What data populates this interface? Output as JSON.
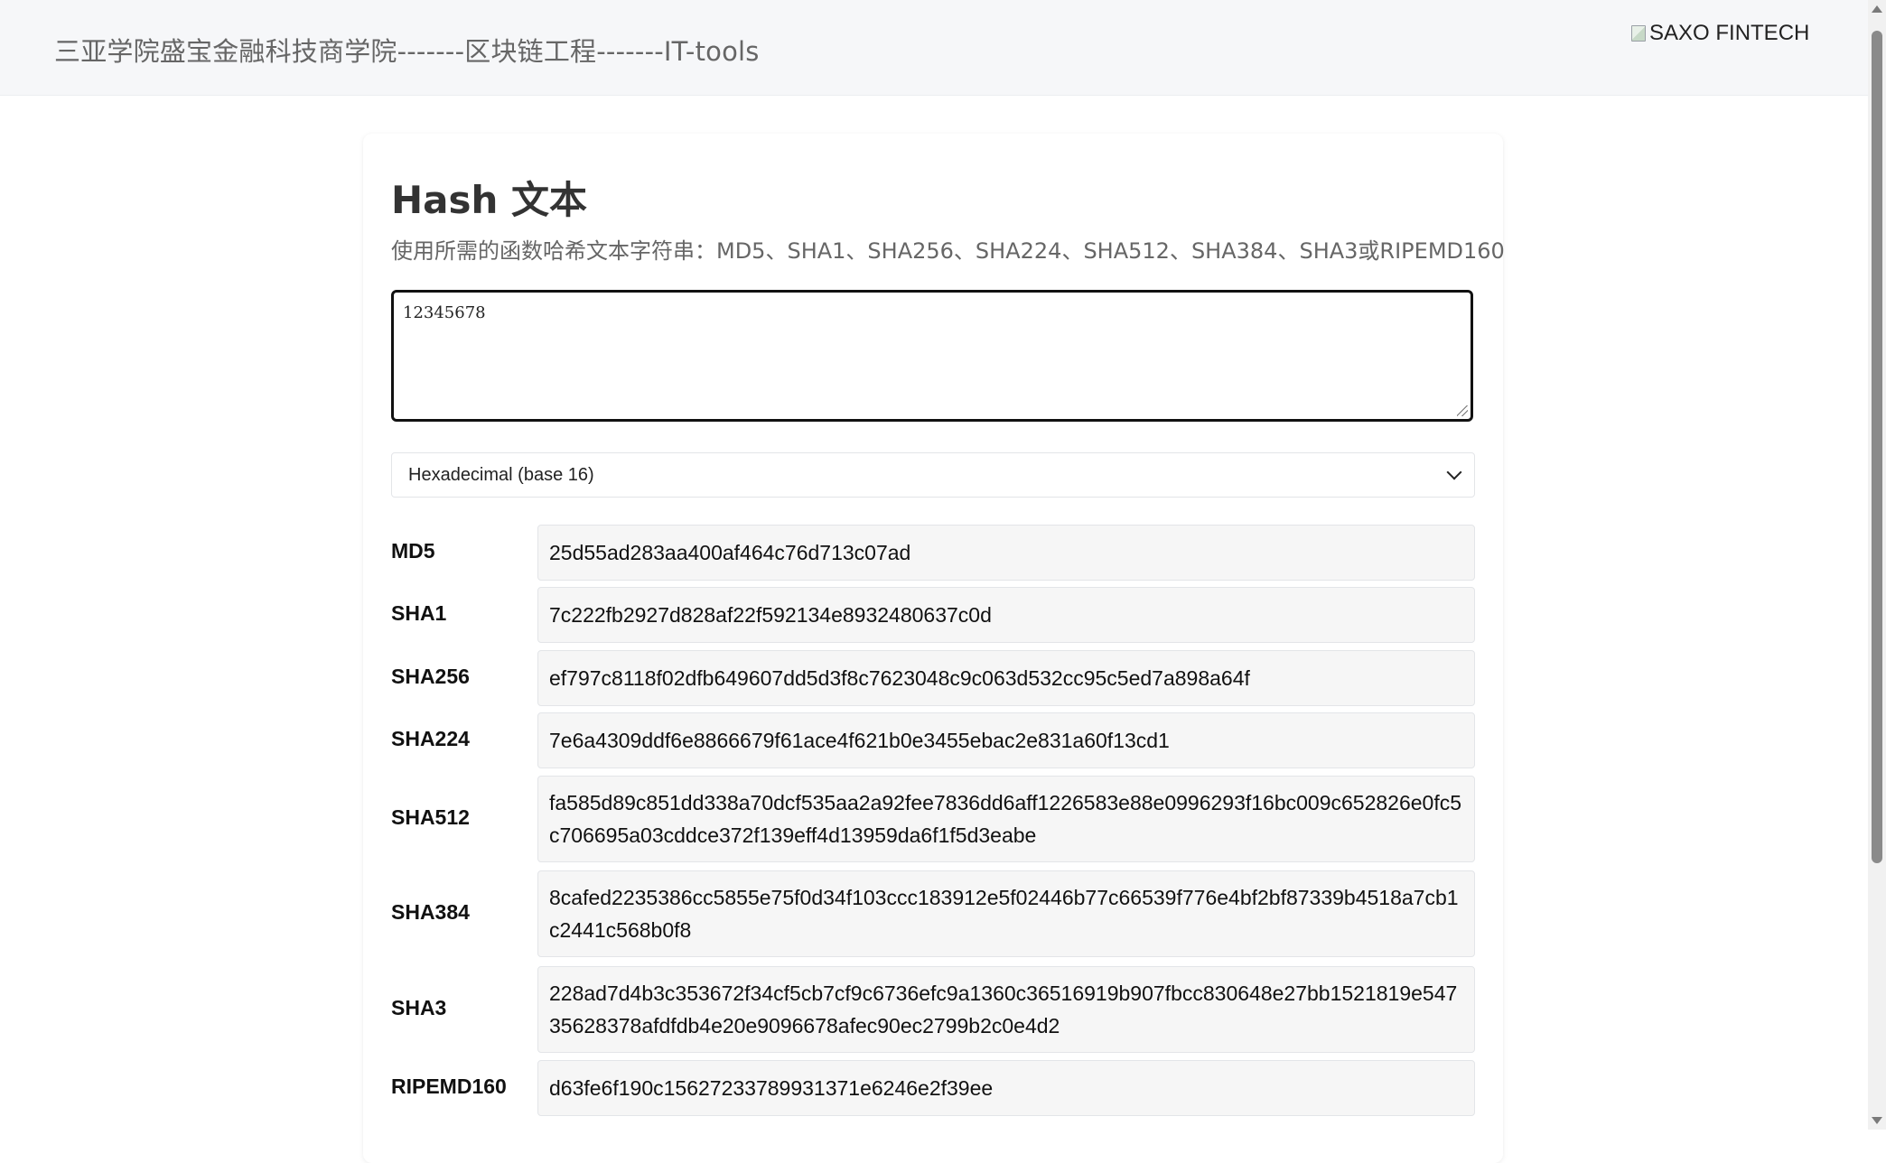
{
  "header": {
    "brand_text": "三亚学院盛宝金融科技商学院-------区块链工程-------IT-tools",
    "logo_alt": "SAXO FINTECH"
  },
  "tool": {
    "title": "Hash 文本",
    "description": "使用所需的函数哈希文本字符串：MD5、SHA1、SHA256、SHA224、SHA512、SHA384、SHA3或RIPEMD160",
    "input_value": "12345678",
    "encoding_selected": "Hexadecimal (base 16)"
  },
  "hashes": [
    {
      "label": "MD5",
      "value": "25d55ad283aa400af464c76d713c07ad"
    },
    {
      "label": "SHA1",
      "value": "7c222fb2927d828af22f592134e8932480637c0d"
    },
    {
      "label": "SHA256",
      "value": "ef797c8118f02dfb649607dd5d3f8c7623048c9c063d532cc95c5ed7a898a64f"
    },
    {
      "label": "SHA224",
      "value": "7e6a4309ddf6e8866679f61ace4f621b0e3455ebac2e831a60f13cd1"
    },
    {
      "label": "SHA512",
      "value": "fa585d89c851dd338a70dcf535aa2a92fee7836dd6aff1226583e88e0996293f16bc009c652826e0fc5c706695a03cddce372f139eff4d13959da6f1f5d3eabe"
    },
    {
      "label": "SHA384",
      "value": "8cafed2235386cc5855e75f0d34f103ccc183912e5f02446b77c66539f776e4bf2bf87339b4518a7cb1c2441c568b0f8"
    },
    {
      "label": "SHA3",
      "value": "228ad7d4b3c353672f34cf5cb7cf9c6736efc9a1360c36516919b907fbcc830648e27bb1521819e54735628378afdfdb4e20e9096678afec90ec2799b2c0e4d2"
    },
    {
      "label": "RIPEMD160",
      "value": "d63fe6f190c15627233789931371e6246e2f39ee"
    }
  ]
}
